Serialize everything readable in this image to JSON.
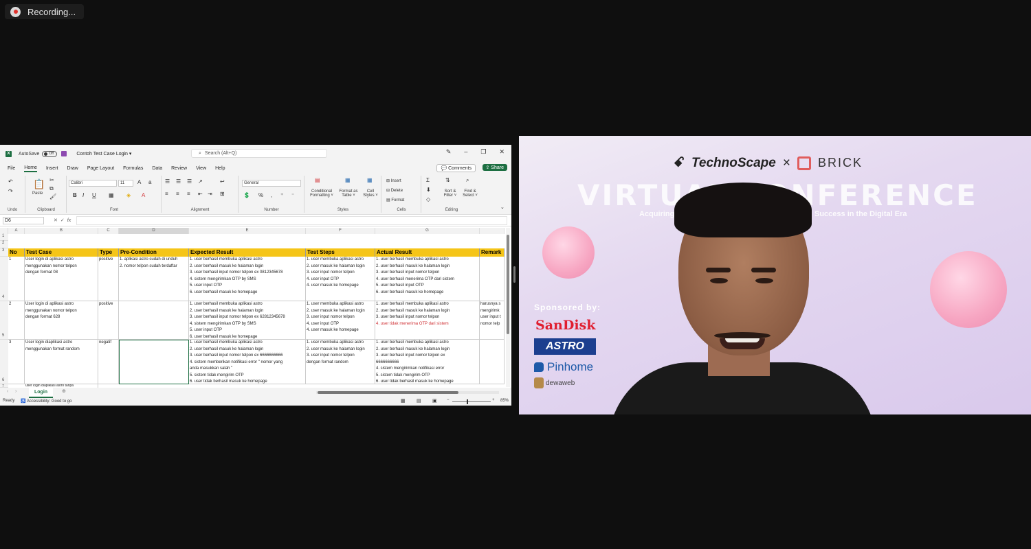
{
  "recording": {
    "label": "Recording..."
  },
  "excel": {
    "autosave_label": "AutoSave",
    "autosave_state": "Off",
    "doc_title": "Contoh Test Case Login ▾",
    "search_placeholder": "Search (Alt+Q)",
    "menu": [
      "File",
      "Home",
      "Insert",
      "Draw",
      "Page Layout",
      "Formulas",
      "Data",
      "Review",
      "View",
      "Help"
    ],
    "comments_label": "Comments",
    "share_label": "Share",
    "ribbon": {
      "undo_label": "Undo",
      "clipboard_label": "Clipboard",
      "paste_label": "Paste",
      "font_label": "Font",
      "font_name": "Calibri",
      "font_size": "11",
      "alignment_label": "Alignment",
      "number_label": "Number",
      "number_format": "General",
      "styles_label": "Styles",
      "conditional_formatting": "Conditional Formatting ˅",
      "format_as_table": "Format as Table ˅",
      "cell_styles": "Cell Styles ˅",
      "cells_label": "Cells",
      "insert": "Insert",
      "delete": "Delete",
      "format": "Format",
      "editing_label": "Editing",
      "sort_filter": "Sort & Filter ˅",
      "find_select": "Find & Select ˅"
    },
    "name_box": "D6",
    "columns": [
      "A",
      "B",
      "C",
      "D",
      "E",
      "F",
      "G",
      "H"
    ],
    "rows": [
      "1",
      "2",
      "3",
      "4",
      "5",
      "6",
      "7"
    ],
    "headers": [
      "No",
      "Test Case",
      "Type",
      "Pre-Condition",
      "Expected Result",
      "Test Steps",
      "Actual Result",
      "Remark"
    ],
    "data": [
      {
        "no": "1",
        "test_case": "User login di aplikasi astro\nmenggunakan nomor telpon\ndengan format 08",
        "type": "positive",
        "pre": "1. aplikasi astro sudah di unduh\n2. nomor telpon sudah terdaftar",
        "expected": "1. user berhasil membuka aplikasi astro\n2. user berhasil masuk ke halaman login\n3. user berhasil input nomor telpon ex 0812345678\n4. sistem mengirimkan OTP by SMS\n5. user input OTP\n6. user berhasil masuk ke homepage",
        "steps": "1. user membuka aplikasi astro\n2. user masuk ke halaman login\n3. user input nomor telpon\n4. user input OTP\n4. user masuk ke homepage",
        "actual": "1. user berhasil membuka aplikasi astro\n2. user berhasil masuk ke halaman login\n3. user berhasil input nomor telpon\n4. user berhasil menerima OTP dari sistem\n5. user berhasil input OTP\n6. user berhasil masuk ke homepage",
        "actual_red": "",
        "remark": ""
      },
      {
        "no": "2",
        "test_case": "User login di aplikasi astro\nmenggunakan nomor telpon\ndengan format 628",
        "type": "positive",
        "pre": "",
        "expected": "1. user berhasil membuka aplikasi astro\n2. user berhasil masuk ke halaman login\n3. user berhasil input nomor telpon ex 62812345678\n4. sistem mengirimkan OTP by SMS\n5. user input OTP\n6. user berhasil masuk ke homepage",
        "steps": "1. user membuka aplikasi astro\n2. user masuk ke halaman login\n3. user input nomor telpon\n4. user input OTP\n4. user masuk ke homepage",
        "actual": "1. user berhasil membuka aplikasi astro\n2. user berhasil masuk ke halaman login\n3. user berhasil input nomor telpon",
        "actual_red": "4. user tidak menerima OTP dari sistem",
        "remark": "harusnya s\nmengirimk\nuser input t\nnomor telp"
      },
      {
        "no": "3",
        "test_case": "User login diaplikasi astro\nmenggunakan format random",
        "type": "negatif",
        "pre": "",
        "expected": "1. user berhasil membuka aplikasi astro\n2. user berhasil masuk ke halaman login\n3. user berhasil input nomor telpon ex 6666666666\n4. sistem memberikan notifikasi error \" nomor yang\nanda masukkan salah \"\n5. sistem tidak mengirim OTP\n6. user tidak berhasil masuk ke homepage",
        "steps": "1. user membuka aplikasi astro\n2. user masuk ke halaman login\n3. user input nomor telpon\ndengan format random",
        "actual": "1. user berhasil membuka aplikasi astro\n2. user berhasil masuk ke halaman login\n3. user berhasil input nomor telpon ex\n6666666666\n4. sistem mengirimkan notifikasi error\n5. sistem tidak mengirim OTP\n6. user tidak berhasil masuk ke homepage",
        "actual_red": "",
        "remark": ""
      }
    ],
    "row7_partial": "user login diaplikasi astro tanpa",
    "sheet_tab": "Login",
    "status_ready": "Ready",
    "accessibility": "Accessibility: Good to go",
    "zoom": "85%"
  },
  "video": {
    "brand_technoscape_a": "Techno",
    "brand_technoscape_b": "Scape",
    "brand_x": "×",
    "brand_brick": "BRICK",
    "title": "VIRTUAL CONFERENCE",
    "subtitle_left": "Acquiring",
    "subtitle_right": "Success in the Digital Era",
    "sponsored_label": "Sponsored by:",
    "sponsors": [
      "SanDisk",
      "ASTRO",
      "Pinhome",
      "dewaweb"
    ]
  },
  "colors": {
    "excel_green": "#1d6f42",
    "header_yellow": "#f5c518",
    "error_red": "#d13438"
  }
}
